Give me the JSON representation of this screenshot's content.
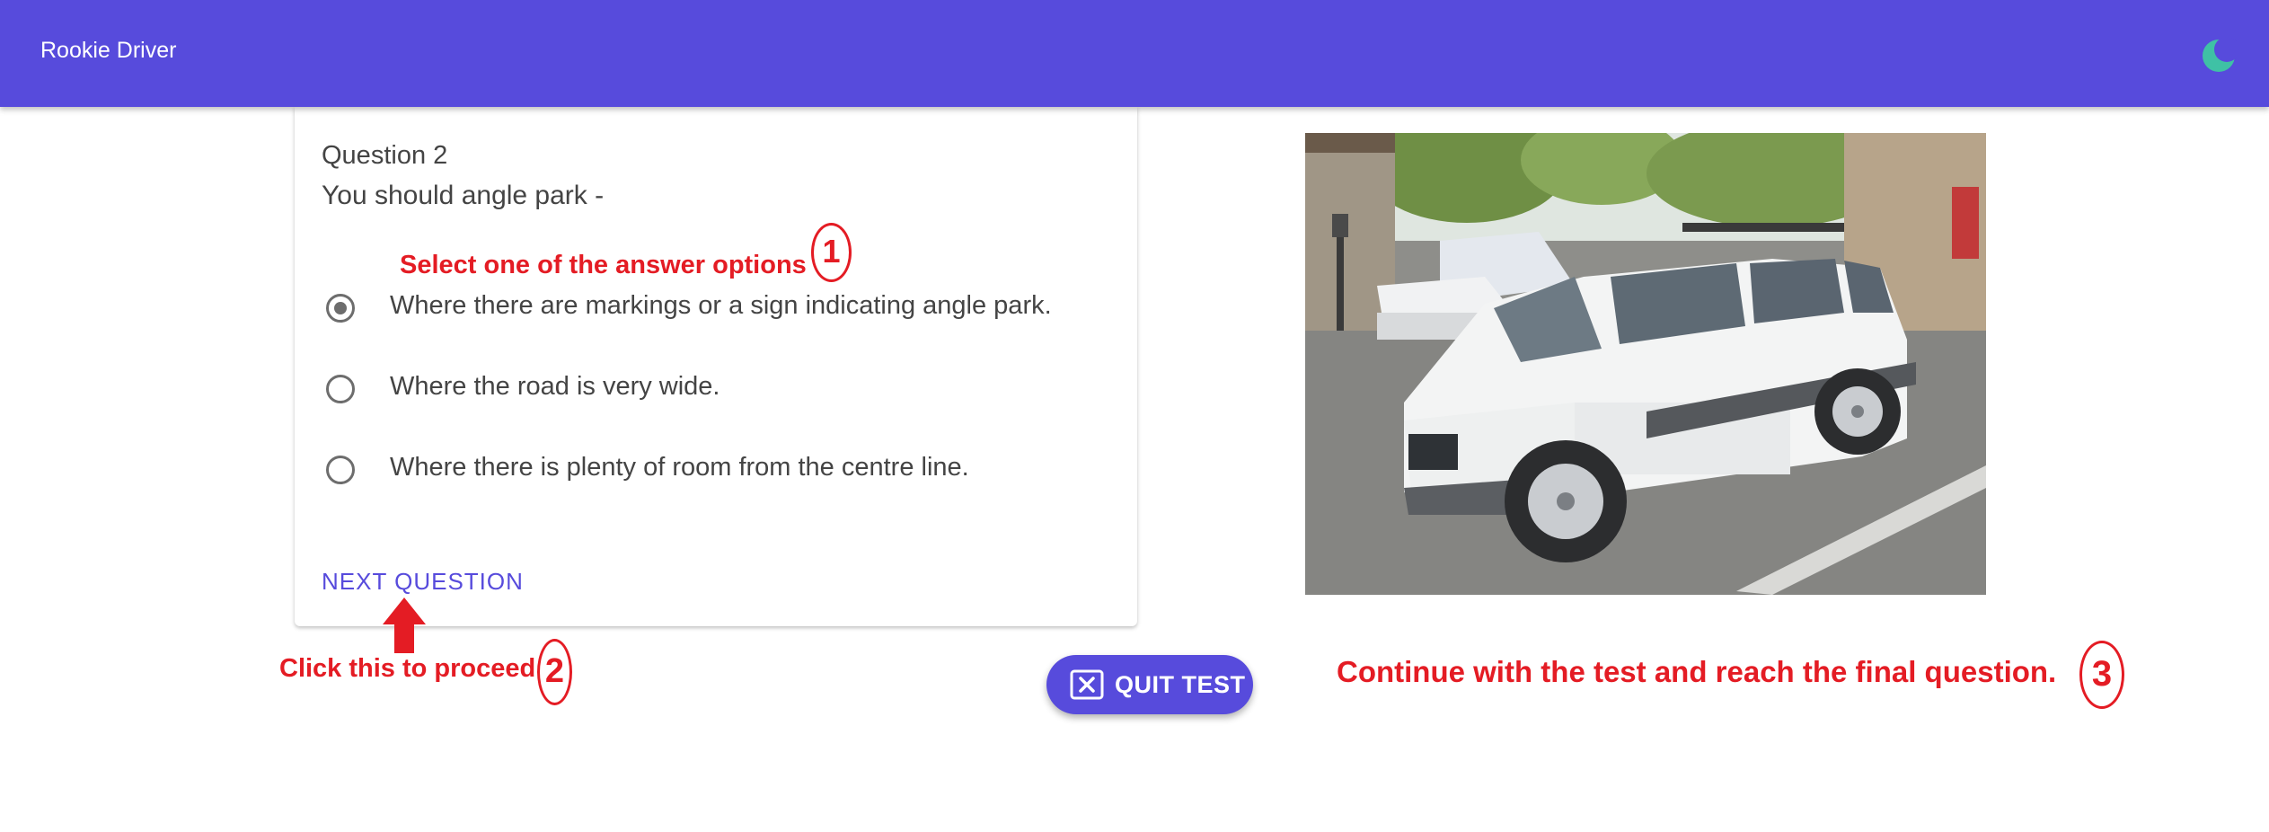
{
  "app": {
    "title": "Rookie Driver",
    "accent_color": "#574bdc",
    "theme_icon": "moon-icon"
  },
  "question": {
    "number_label": "Question 2",
    "text": "You should angle park -",
    "options": [
      {
        "label": "Where there are markings or a sign indicating angle park.",
        "selected": true
      },
      {
        "label": "Where the road is very wide.",
        "selected": false
      },
      {
        "label": "Where there is plenty of room from the centre line.",
        "selected": false
      }
    ],
    "next_label": "NEXT QUESTION"
  },
  "quit": {
    "label": "QUIT TEST",
    "icon": "close-box-icon"
  },
  "annotations": {
    "color": "#e41c24",
    "step1_text": "Select one of the answer options",
    "step1_number": "1",
    "step2_text": "Click this to proceed",
    "step2_number": "2",
    "step3_text": "Continue with the test and reach the final question.",
    "step3_number": "3"
  }
}
